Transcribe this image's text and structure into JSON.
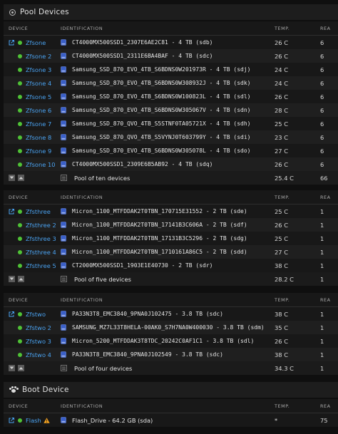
{
  "pool_section": {
    "title": "Pool Devices",
    "icon": "circle-dot-icon"
  },
  "boot_section": {
    "title": "Boot Device",
    "icon": "paw-icon"
  },
  "columns": {
    "device": "DEVICE",
    "identification": "IDENTIFICATION",
    "temp": "TEMP.",
    "reads": "REA"
  },
  "pools": [
    {
      "rows": [
        {
          "name": "Zfsone",
          "id": "CT4000MX500SSD1_2307E6AE2C81 - 4 TB (sdb)",
          "temp": "26 C",
          "reads": "6"
        },
        {
          "name": "Zfsone 2",
          "id": "CT4000MX500SSD1_2311E6BA4BAF - 4 TB (sdc)",
          "temp": "26 C",
          "reads": "6"
        },
        {
          "name": "Zfsone 3",
          "id": "Samsung_SSD_870_EVO_4TB_S6BDNS0W201973R - 4 TB (sdj)",
          "temp": "24 C",
          "reads": "6"
        },
        {
          "name": "Zfsone 4",
          "id": "Samsung_SSD_870_EVO_4TB_S6BDNS0W308932J - 4 TB (sdk)",
          "temp": "24 C",
          "reads": "6"
        },
        {
          "name": "Zfsone 5",
          "id": "Samsung_SSD_870_EVO_4TB_S6BDNS0W100823L - 4 TB (sdl)",
          "temp": "26 C",
          "reads": "6"
        },
        {
          "name": "Zfsone 6",
          "id": "Samsung_SSD_870_EVO_4TB_S6BDNS0W305067V - 4 TB (sdn)",
          "temp": "28 C",
          "reads": "6"
        },
        {
          "name": "Zfsone 7",
          "id": "Samsung_SSD_870_QVO_4TB_S5STNF0TA05721X - 4 TB (sdh)",
          "temp": "25 C",
          "reads": "6"
        },
        {
          "name": "Zfsone 8",
          "id": "Samsung_SSD_870_QVO_4TB_S5VYNJ0T603799Y - 4 TB (sdi)",
          "temp": "23 C",
          "reads": "6"
        },
        {
          "name": "Zfsone 9",
          "id": "Samsung_SSD_870_EVO_4TB_S6BDNS0W305078L - 4 TB (sdo)",
          "temp": "27 C",
          "reads": "6"
        },
        {
          "name": "Zfsone 10",
          "id": "CT4000MX500SSD1_2309E6B5AB92 - 4 TB (sdq)",
          "temp": "26 C",
          "reads": "6"
        }
      ],
      "total": {
        "id": "Pool of ten devices",
        "temp": "25.4 C",
        "reads": "66"
      }
    },
    {
      "rows": [
        {
          "name": "Zfsthree",
          "id": "Micron_1100_MTFDDAK2T0TBN_170715E31552 - 2 TB (sde)",
          "temp": "25 C",
          "reads": "1"
        },
        {
          "name": "Zfsthree 2",
          "id": "Micron_1100_MTFDDAK2T0TBN_17141B3C606A - 2 TB (sdf)",
          "temp": "26 C",
          "reads": "1"
        },
        {
          "name": "Zfsthree 3",
          "id": "Micron_1100_MTFDDAK2T0TBN_17131B3C5296 - 2 TB (sdg)",
          "temp": "25 C",
          "reads": "1"
        },
        {
          "name": "Zfsthree 4",
          "id": "Micron_1100_MTFDDAK2T0TBN_1710161A86C5 - 2 TB (sdd)",
          "temp": "27 C",
          "reads": "1"
        },
        {
          "name": "Zfsthree 5",
          "id": "CT2000MX500SSD1_1903E1E40730 - 2 TB (sdr)",
          "temp": "38 C",
          "reads": "1"
        }
      ],
      "total": {
        "id": "Pool of five devices",
        "temp": "28.2 C",
        "reads": "1"
      }
    },
    {
      "rows": [
        {
          "name": "Zfstwo",
          "id": "PA33N3T8_EMC3840_9PNA0J102475 - 3.8 TB (sdc)",
          "temp": "38 C",
          "reads": "1"
        },
        {
          "name": "Zfstwo 2",
          "id": "SAMSUNG_MZ7L33T8HELA-00AK0_S7H7NA0W400030 - 3.8 TB (sdm)",
          "temp": "35 C",
          "reads": "1"
        },
        {
          "name": "Zfstwo 3",
          "id": "Micron_5200_MTFDDAK3T8TDC_20242C0AF1C1 - 3.8 TB (sdl)",
          "temp": "26 C",
          "reads": "1"
        },
        {
          "name": "Zfstwo 4",
          "id": "PA33N3T8_EMC3840_9PNA0J102549 - 3.8 TB (sdc)",
          "temp": "38 C",
          "reads": "1"
        }
      ],
      "total": {
        "id": "Pool of four devices",
        "temp": "34.3 C",
        "reads": "1"
      }
    }
  ],
  "boot": {
    "row": {
      "name": "Flash",
      "id": "Flash_Drive - 64.2 GB (sda)",
      "temp": "*",
      "reads": "75"
    }
  },
  "colors": {
    "status_green": "#4fc236",
    "link_blue": "#4aa2f0",
    "warning": "#f0a020"
  }
}
